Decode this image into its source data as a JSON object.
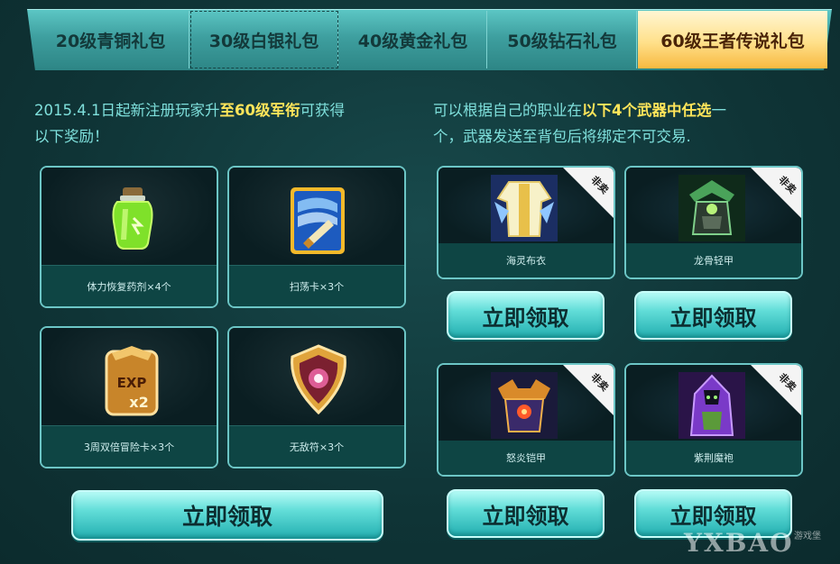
{
  "tabs": [
    {
      "label": "20级青铜礼包"
    },
    {
      "label": "30级白银礼包"
    },
    {
      "label": "40级黄金礼包"
    },
    {
      "label": "50级钻石礼包"
    },
    {
      "label": "60级王者传说礼包"
    }
  ],
  "active_tab": 4,
  "left": {
    "intro_prefix": "2015.4.1日起新注册玩家升",
    "intro_highlight": "至60级军衔",
    "intro_suffix": "可获得",
    "intro_line2": "以下奖励！",
    "items": [
      {
        "name": "体力恢复药剂×4个",
        "icon": "potion-icon"
      },
      {
        "name": "扫荡卡×3个",
        "icon": "sweep-card-icon"
      },
      {
        "name": "3周双倍冒险卡×3个",
        "icon": "exp-card-icon"
      },
      {
        "name": "无敌符×3个",
        "icon": "shield-icon"
      }
    ],
    "claim_label": "立即领取"
  },
  "right": {
    "intro_prefix": "可以根据自己的职业在",
    "intro_highlight": "以下4个武器中任选",
    "intro_suffix": "一",
    "intro_line2": "个，武器发送至背包后将绑定不可交易.",
    "badge": "非卖",
    "weapons": [
      {
        "name": "海灵布衣",
        "icon": "robe-icon"
      },
      {
        "name": "龙骨轻甲",
        "icon": "light-armor-icon"
      },
      {
        "name": "怒炎铠甲",
        "icon": "heavy-armor-icon"
      },
      {
        "name": "紫荆魔袍",
        "icon": "magic-robe-icon"
      }
    ],
    "claim_label": "立即领取"
  },
  "watermark": {
    "logo": "YXBAO",
    "sub": "游戏堡"
  },
  "colors": {
    "accent_text": "#7fe0dc",
    "highlight": "#ffe55a",
    "button": "#61ddd8",
    "background": "#0f3436"
  }
}
